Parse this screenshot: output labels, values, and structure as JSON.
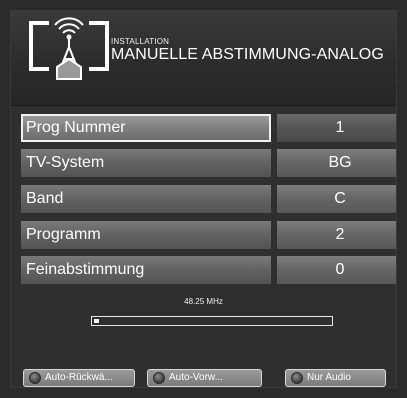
{
  "header": {
    "category": "INSTALLATION",
    "title": "MANUELLE ABSTIMMUNG-ANALOG",
    "icon": "antenna-installation-icon"
  },
  "rows": [
    {
      "label": "Prog Nummer",
      "value": "1",
      "selected": true
    },
    {
      "label": "TV-System",
      "value": "BG",
      "selected": false
    },
    {
      "label": "Band",
      "value": "C",
      "selected": false
    },
    {
      "label": "Programm",
      "value": "2",
      "selected": false
    },
    {
      "label": "Feinabstimmung",
      "value": "0",
      "selected": false
    }
  ],
  "frequency": {
    "text": "48.25 MHz",
    "level": 0.02
  },
  "footer": {
    "buttons": [
      {
        "label": "Auto-Rückwä...",
        "icon": "red-button-icon"
      },
      {
        "label": "Auto-Vorw...",
        "icon": "green-button-icon"
      },
      {
        "label": "Nur Audio",
        "icon": "blue-button-icon"
      }
    ]
  },
  "colors": {
    "background": "#2f2f2f",
    "row": "#666666",
    "highlight": "#f2f2f2"
  }
}
